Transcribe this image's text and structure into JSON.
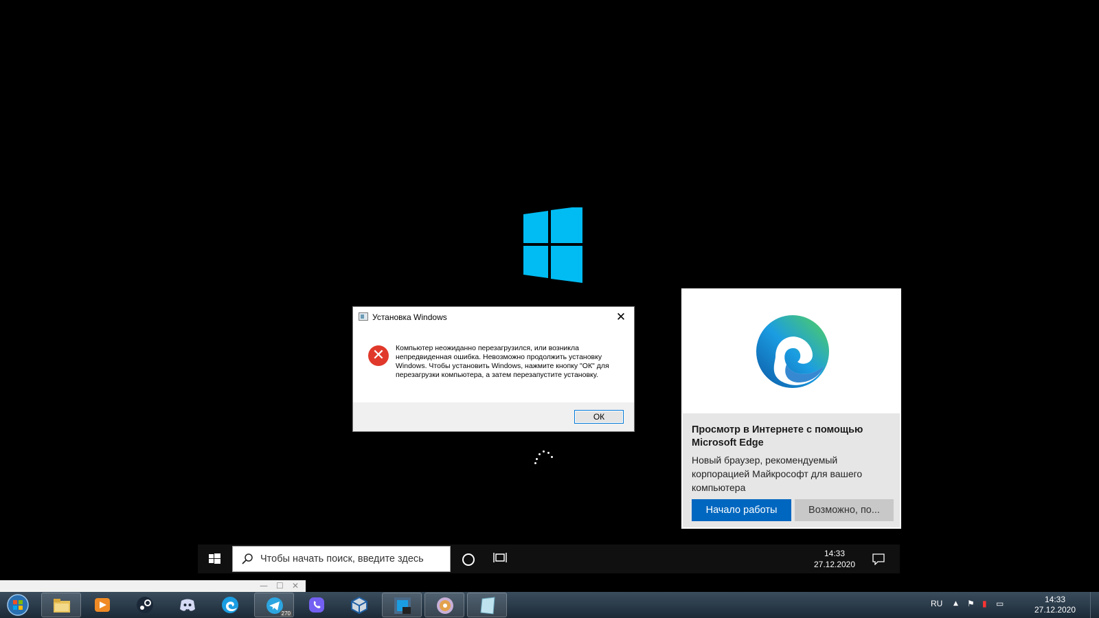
{
  "setup_dialog": {
    "title": "Установка Windows",
    "message": "Компьютер неожиданно перезагрузился, или возникла непредвиденная ошибка. Невозможно продолжить установку Windows. Чтобы установить Windows, нажмите кнопку \"ОК\" для перезагрузки компьютера, а затем перезапустите установку.",
    "ok_label": "ОК"
  },
  "edge_card": {
    "heading": "Просмотр в Интернете с помощью Microsoft Edge",
    "description": "Новый браузер, рекомендуемый корпорацией Майкрософт для вашего компьютера",
    "start_button": "Начало работы",
    "maybe_button": "Возможно, по..."
  },
  "guest_taskbar": {
    "search_placeholder": "Чтобы начать поиск, введите здесь",
    "time": "14:33",
    "date": "27.12.2020"
  },
  "host_taskbar": {
    "items": [
      {
        "name": "file-explorer-icon"
      },
      {
        "name": "media-player-icon"
      },
      {
        "name": "steam-icon"
      },
      {
        "name": "discord-icon"
      },
      {
        "name": "edge-icon"
      },
      {
        "name": "telegram-icon",
        "badge": "270"
      },
      {
        "name": "viber-icon"
      },
      {
        "name": "virtualbox-icon"
      },
      {
        "name": "windows10-vm-icon"
      },
      {
        "name": "disc-icon"
      },
      {
        "name": "notepad-icon"
      }
    ],
    "language": "RU",
    "time": "14:33",
    "date": "27.12.2020"
  },
  "colors": {
    "windows_logo": "#00bcf2",
    "error_red": "#e0392b",
    "edge_button": "#0067c0"
  }
}
